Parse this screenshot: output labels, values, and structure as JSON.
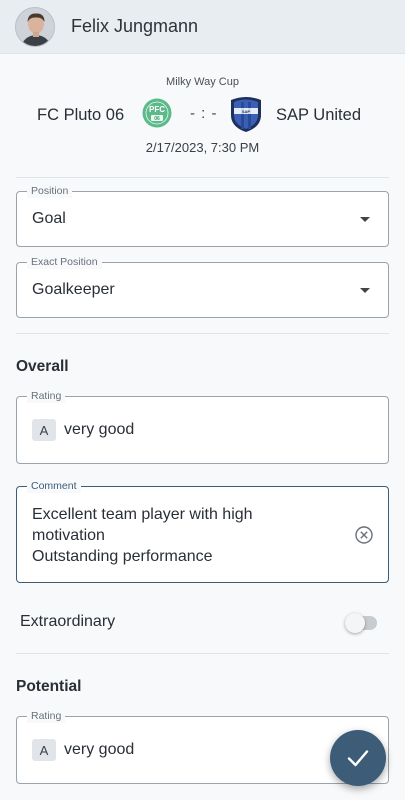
{
  "header": {
    "user_name": "Felix Jungmann"
  },
  "match": {
    "competition": "Milky Way Cup",
    "home_team": "FC Pluto 06",
    "score": "- : -",
    "away_team": "SAP United",
    "datetime": "2/17/2023, 7:30 PM"
  },
  "position": {
    "label": "Position",
    "value": "Goal"
  },
  "exact_position": {
    "label": "Exact Position",
    "value": "Goalkeeper"
  },
  "overall": {
    "title": "Overall",
    "rating_label": "Rating",
    "grade": "A",
    "rating_value": "very good",
    "comment_label": "Comment",
    "comment_line1": "Excellent team player with high",
    "comment_line2": "motivation",
    "comment_line3": "Outstanding performance",
    "extraordinary_label": "Extraordinary",
    "extraordinary_on": false
  },
  "potential": {
    "title": "Potential",
    "rating_label": "Rating",
    "grade": "A",
    "rating_value": "very good"
  },
  "colors": {
    "accent": "#3d5c78",
    "home_logo": "#5cb98a",
    "away_logo": "#3a5fb5"
  },
  "icons": {
    "avatar": "user-photo",
    "home_logo": "fc-pluto-crest-icon",
    "away_logo": "sap-united-crest-icon",
    "dropdown": "caret-down-icon",
    "clear": "clear-circle-x-icon",
    "submit": "checkmark-icon"
  }
}
